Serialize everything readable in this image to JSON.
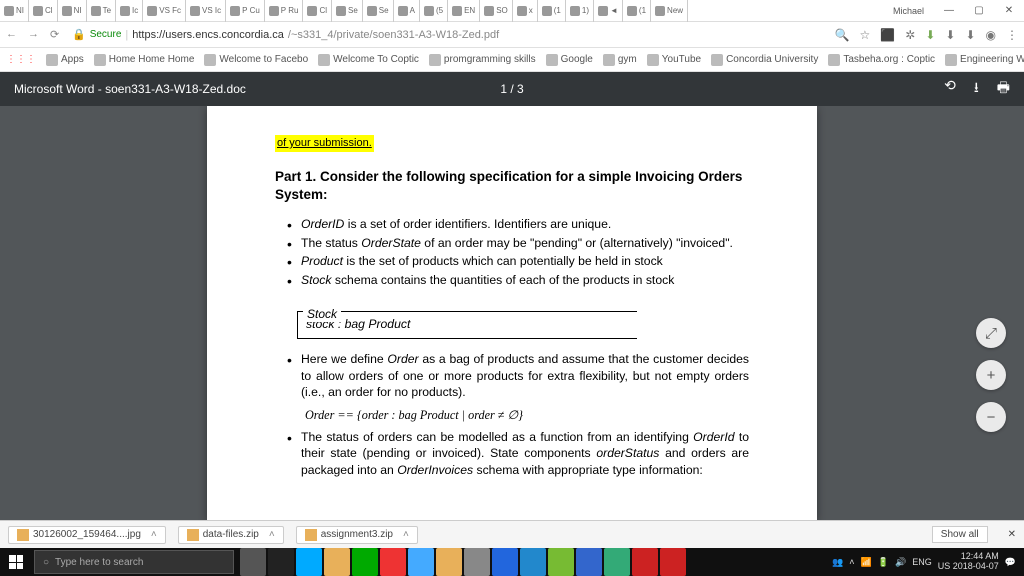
{
  "window": {
    "user_label": "Michael"
  },
  "browser": {
    "tabs": [
      "NI",
      "Cl",
      "NI",
      "Te",
      "Ic",
      "VS Fc",
      "VS Ic",
      "P Cu",
      "P Ru",
      "Cl",
      "Se",
      "Se",
      "A",
      "(5",
      "EN",
      "SO",
      "x",
      "(1",
      "1)",
      "◄",
      "(1",
      "New"
    ],
    "secure_label": "Secure",
    "url_host": "https://users.encs.concordia.ca",
    "url_path": "/~s331_4/private/soen331-A3-W18-Zed.pdf",
    "bookmarks": [
      "Apps",
      "Home Home Home",
      "Welcome to Facebo",
      "Welcome To Coptic",
      "promgramming skills",
      "Google",
      "gym",
      "YouTube",
      "Concordia University",
      "Tasbeha.org : Coptic",
      "Engineering Writing"
    ]
  },
  "pdf": {
    "title": "Microsoft Word - soen331-A3-W18-Zed.doc",
    "page_indicator": "1 / 3",
    "top_fragment": "of your submission.",
    "part_title": "Part 1. Consider the following specification for a simple Invoicing Orders System:",
    "bullets_a": [
      "<em class='i'>OrderID</em> is a set of order identifiers. Identifiers are unique.",
      "The status <em class='i'>OrderState</em> of an order may be \"pending\" or (alternatively) \"invoiced\".",
      "<em class='i'>Product</em> is the set of products which can potentially be held in stock",
      "<em class='i'>Stock</em> schema contains the quantities of each of the products in stock"
    ],
    "schema": {
      "label": "Stock",
      "body": "stock : bag Product"
    },
    "bullet_b1": "Here we define <em class='i'>Order</em> as a bag of products and assume that the customer decides to allow orders of one or more products for extra flexibility, but not empty orders (i.e., an order for no products).",
    "order_def": "Order == {order : bag Product | order ≠ ∅}",
    "bullet_b2": "The status of orders can be modelled as a function from an identifying <em class='i'>OrderId</em> to their state (pending or invoiced). State components <em class='i'>orderStatus</em> and orders are packaged into an <em class='i'>OrderInvoices</em> schema with appropriate type information:"
  },
  "downloads": {
    "items": [
      "30126002_159464....jpg",
      "data-files.zip",
      "assignment3.zip"
    ],
    "show_all": "Show all"
  },
  "taskbar": {
    "search_placeholder": "Type here to search",
    "lang": "ENG",
    "region": "US",
    "time": "12:44 AM",
    "date": "2018-04-07"
  }
}
